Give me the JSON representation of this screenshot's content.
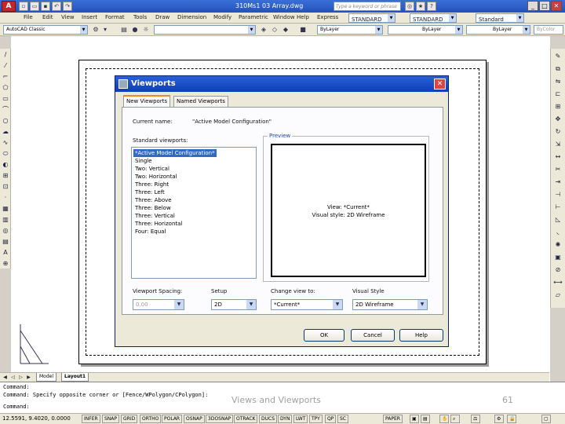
{
  "app": {
    "logo": "A",
    "title": "310Ms1  03  Array.dwg",
    "search_placeholder": "Type a keyword or phrase"
  },
  "menubar": {
    "items": [
      "File",
      "Edit",
      "View",
      "Insert",
      "Format",
      "Tools",
      "Draw",
      "Dimension",
      "Modify",
      "Parametric",
      "Window",
      "Help",
      "Express"
    ],
    "style_combo1": "STANDARD",
    "style_combo2": "STANDARD",
    "style_combo3": "Standard"
  },
  "toolbar2": {
    "workspace": "AutoCAD Classic",
    "layer_color": "ByLayer",
    "linetype": "ByLayer",
    "lineweight": "ByLayer",
    "plotstyle": "ByColor"
  },
  "dialog": {
    "title": "Viewports",
    "close": "✕",
    "tabs": [
      "New Viewports",
      "Named Viewports"
    ],
    "current_name_label": "Current name:",
    "current_name_value": "\"Active Model Configuration\"",
    "standard_label": "Standard viewports:",
    "standard_items": [
      "*Active Model Configuration*",
      "Single",
      "Two: Vertical",
      "Two: Horizontal",
      "Three: Right",
      "Three: Left",
      "Three: Above",
      "Three: Below",
      "Three: Vertical",
      "Three: Horizontal",
      "Four: Equal"
    ],
    "preview_label": "Preview",
    "preview_line1": "View: *Current*",
    "preview_line2": "Visual style: 2D Wireframe",
    "spacing_label": "Viewport Spacing:",
    "spacing_value": "0.00",
    "setup_label": "Setup",
    "setup_value": "2D",
    "change_view_label": "Change view to:",
    "change_view_value": "*Current*",
    "visual_style_label": "Visual Style",
    "visual_style_value": "2D Wireframe",
    "ok": "OK",
    "cancel": "Cancel",
    "help": "Help"
  },
  "layout_tabs": [
    "Model",
    "Layout1"
  ],
  "command": {
    "line1": "Command:",
    "line2": "Command: Specify opposite corner or [Fence/WPolygon/CPolygon]:",
    "line3": "Command:"
  },
  "slide": {
    "footer": "Views and Viewports",
    "number": "61"
  },
  "status": {
    "coords": "12.5591, 9.4020, 0.0000",
    "buttons": [
      "INFER",
      "SNAP",
      "GRID",
      "ORTHO",
      "POLAR",
      "OSNAP",
      "3DOSNAP",
      "OTRACK",
      "DUCS",
      "DYN",
      "LWT",
      "TPY",
      "QP",
      "SC"
    ],
    "paper": "PAPER"
  }
}
